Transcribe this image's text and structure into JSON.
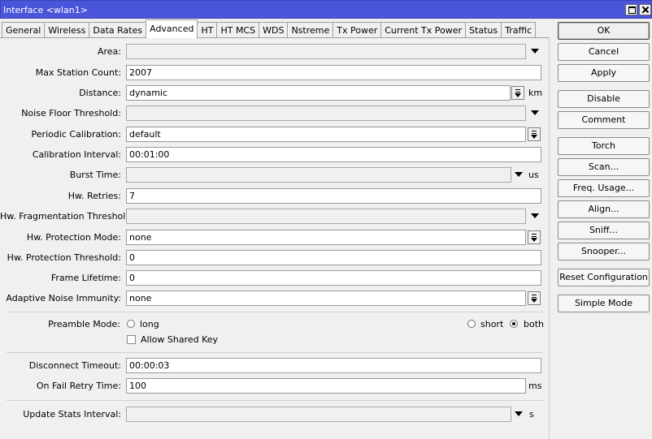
{
  "window": {
    "title": "Interface <wlan1>"
  },
  "tabs": [
    {
      "label": "General"
    },
    {
      "label": "Wireless"
    },
    {
      "label": "Data Rates"
    },
    {
      "label": "Advanced"
    },
    {
      "label": "HT"
    },
    {
      "label": "HT MCS"
    },
    {
      "label": "WDS"
    },
    {
      "label": "Nstreme"
    },
    {
      "label": "Tx Power"
    },
    {
      "label": "Current Tx Power"
    },
    {
      "label": "Status"
    },
    {
      "label": "Traffic"
    }
  ],
  "active_tab": "Advanced",
  "fields": {
    "area": {
      "label": "Area:",
      "value": ""
    },
    "max_station_count": {
      "label": "Max Station Count:",
      "value": "2007"
    },
    "distance": {
      "label": "Distance:",
      "value": "dynamic",
      "unit": "km"
    },
    "noise_floor_threshold": {
      "label": "Noise Floor Threshold:",
      "value": ""
    },
    "periodic_calibration": {
      "label": "Periodic Calibration:",
      "value": "default"
    },
    "calibration_interval": {
      "label": "Calibration Interval:",
      "value": "00:01:00"
    },
    "burst_time": {
      "label": "Burst Time:",
      "value": "",
      "unit": "us"
    },
    "hw_retries": {
      "label": "Hw. Retries:",
      "value": "7"
    },
    "hw_fragmentation_threshold": {
      "label": "Hw. Fragmentation Threshold:",
      "value": ""
    },
    "hw_protection_mode": {
      "label": "Hw. Protection Mode:",
      "value": "none"
    },
    "hw_protection_threshold": {
      "label": "Hw. Protection Threshold:",
      "value": "0"
    },
    "frame_lifetime": {
      "label": "Frame Lifetime:",
      "value": "0"
    },
    "adaptive_noise_immunity": {
      "label": "Adaptive Noise Immunity:",
      "value": "none"
    },
    "disconnect_timeout": {
      "label": "Disconnect Timeout:",
      "value": "00:00:03"
    },
    "on_fail_retry_time": {
      "label": "On Fail Retry Time:",
      "value": "100",
      "unit": "ms"
    },
    "update_stats_interval": {
      "label": "Update Stats Interval:",
      "value": "",
      "unit": "s"
    }
  },
  "preamble": {
    "label": "Preamble Mode:",
    "options": [
      {
        "label": "long",
        "checked": false
      },
      {
        "label": "short",
        "checked": false
      },
      {
        "label": "both",
        "checked": true
      }
    ]
  },
  "allow_shared_key": {
    "label": "Allow Shared Key",
    "checked": false
  },
  "buttons": {
    "ok": "OK",
    "cancel": "Cancel",
    "apply": "Apply",
    "disable": "Disable",
    "comment": "Comment",
    "torch": "Torch",
    "scan": "Scan...",
    "freq_usage": "Freq. Usage...",
    "align": "Align...",
    "sniff": "Sniff...",
    "snooper": "Snooper...",
    "reset_configuration": "Reset Configuration",
    "simple_mode": "Simple Mode"
  }
}
